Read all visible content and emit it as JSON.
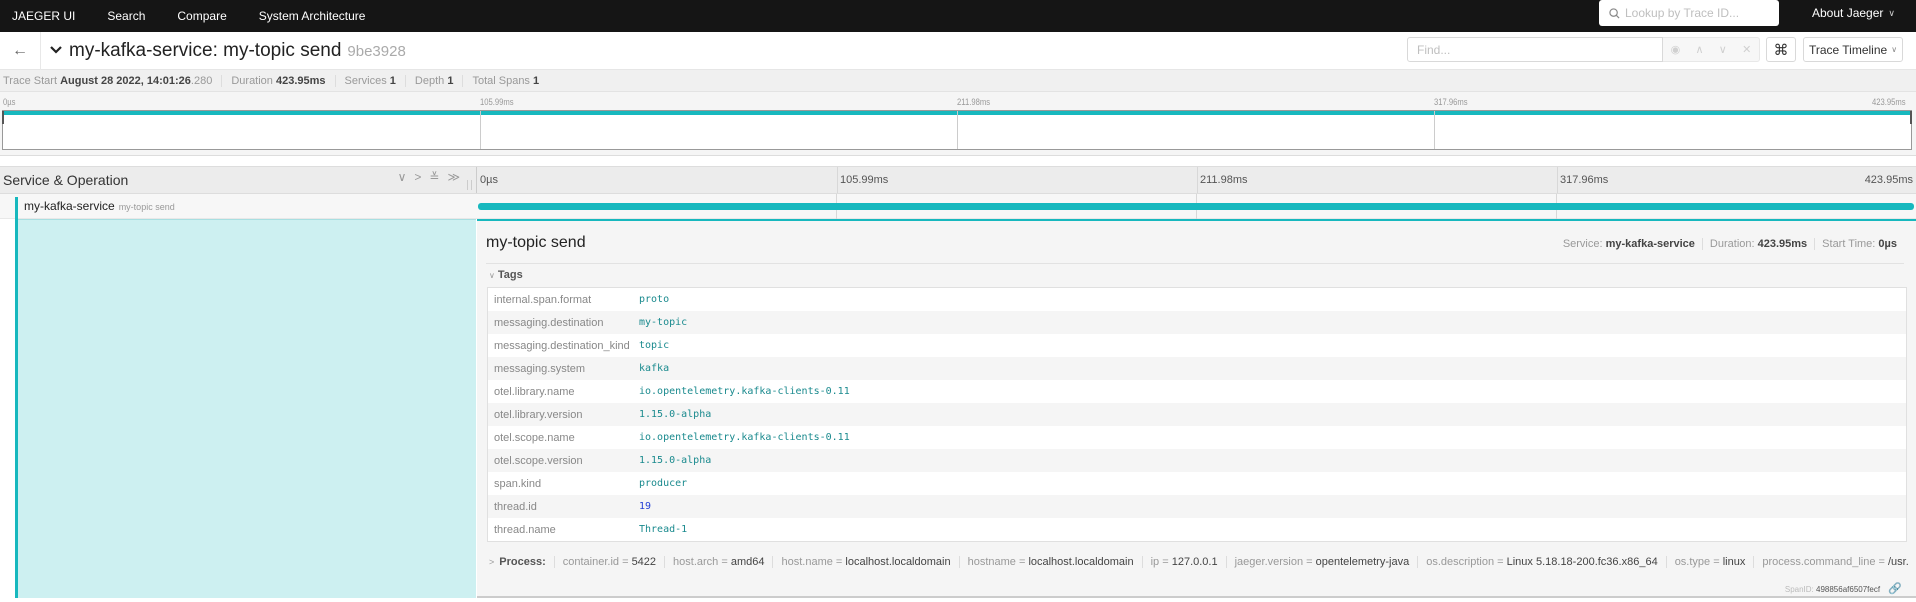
{
  "topnav": {
    "brand": "JAEGER UI",
    "links": [
      "Search",
      "Compare",
      "System Architecture"
    ],
    "lookup_placeholder": "Lookup by Trace ID...",
    "about": "About Jaeger"
  },
  "trace": {
    "title": "my-kafka-service: my-topic send",
    "trace_id": "9be3928",
    "find_placeholder": "Find...",
    "view_label": "Trace Timeline",
    "keyboard_icon": "⌘"
  },
  "summary": {
    "trace_start_label": "Trace Start",
    "trace_start_value": "August 28 2022, 14:01:26",
    "trace_start_ms": ".280",
    "duration_label": "Duration",
    "duration_value": "423.95ms",
    "services_label": "Services",
    "services_value": "1",
    "depth_label": "Depth",
    "depth_value": "1",
    "total_spans_label": "Total Spans",
    "total_spans_value": "1"
  },
  "timeline": {
    "ticks": [
      "0µs",
      "105.99ms",
      "211.98ms",
      "317.96ms",
      "423.95ms"
    ],
    "header_title": "Service & Operation"
  },
  "span": {
    "service": "my-kafka-service",
    "operation": "my-topic send",
    "start_fraction": 0.0,
    "duration_fraction": 1.0,
    "color": "#17b8be"
  },
  "detail": {
    "title": "my-topic send",
    "service_label": "Service:",
    "service_value": "my-kafka-service",
    "duration_label": "Duration:",
    "duration_value": "423.95ms",
    "start_label": "Start Time:",
    "start_value": "0µs",
    "tags_label": "Tags",
    "tags": [
      {
        "key": "internal.span.format",
        "value": "proto"
      },
      {
        "key": "messaging.destination",
        "value": "my-topic"
      },
      {
        "key": "messaging.destination_kind",
        "value": "topic"
      },
      {
        "key": "messaging.system",
        "value": "kafka"
      },
      {
        "key": "otel.library.name",
        "value": "io.opentelemetry.kafka-clients-0.11"
      },
      {
        "key": "otel.library.version",
        "value": "1.15.0-alpha"
      },
      {
        "key": "otel.scope.name",
        "value": "io.opentelemetry.kafka-clients-0.11"
      },
      {
        "key": "otel.scope.version",
        "value": "1.15.0-alpha"
      },
      {
        "key": "span.kind",
        "value": "producer"
      },
      {
        "key": "thread.id",
        "value": "19",
        "numeric": true
      },
      {
        "key": "thread.name",
        "value": "Thread-1"
      }
    ],
    "process_label": "Process:",
    "process": [
      {
        "key": "container.id",
        "value": "5422"
      },
      {
        "key": "host.arch",
        "value": "amd64"
      },
      {
        "key": "host.name",
        "value": "localhost.localdomain"
      },
      {
        "key": "hostname",
        "value": "localhost.localdomain"
      },
      {
        "key": "ip",
        "value": "127.0.0.1"
      },
      {
        "key": "jaeger.version",
        "value": "opentelemetry-java"
      },
      {
        "key": "os.description",
        "value": "Linux 5.18.18-200.fc36.x86_64"
      },
      {
        "key": "os.type",
        "value": "linux"
      },
      {
        "key": "process.command_line",
        "value": "/usr..."
      }
    ],
    "span_id_label": "SpanID:",
    "span_id": "498856af6507fecf"
  }
}
